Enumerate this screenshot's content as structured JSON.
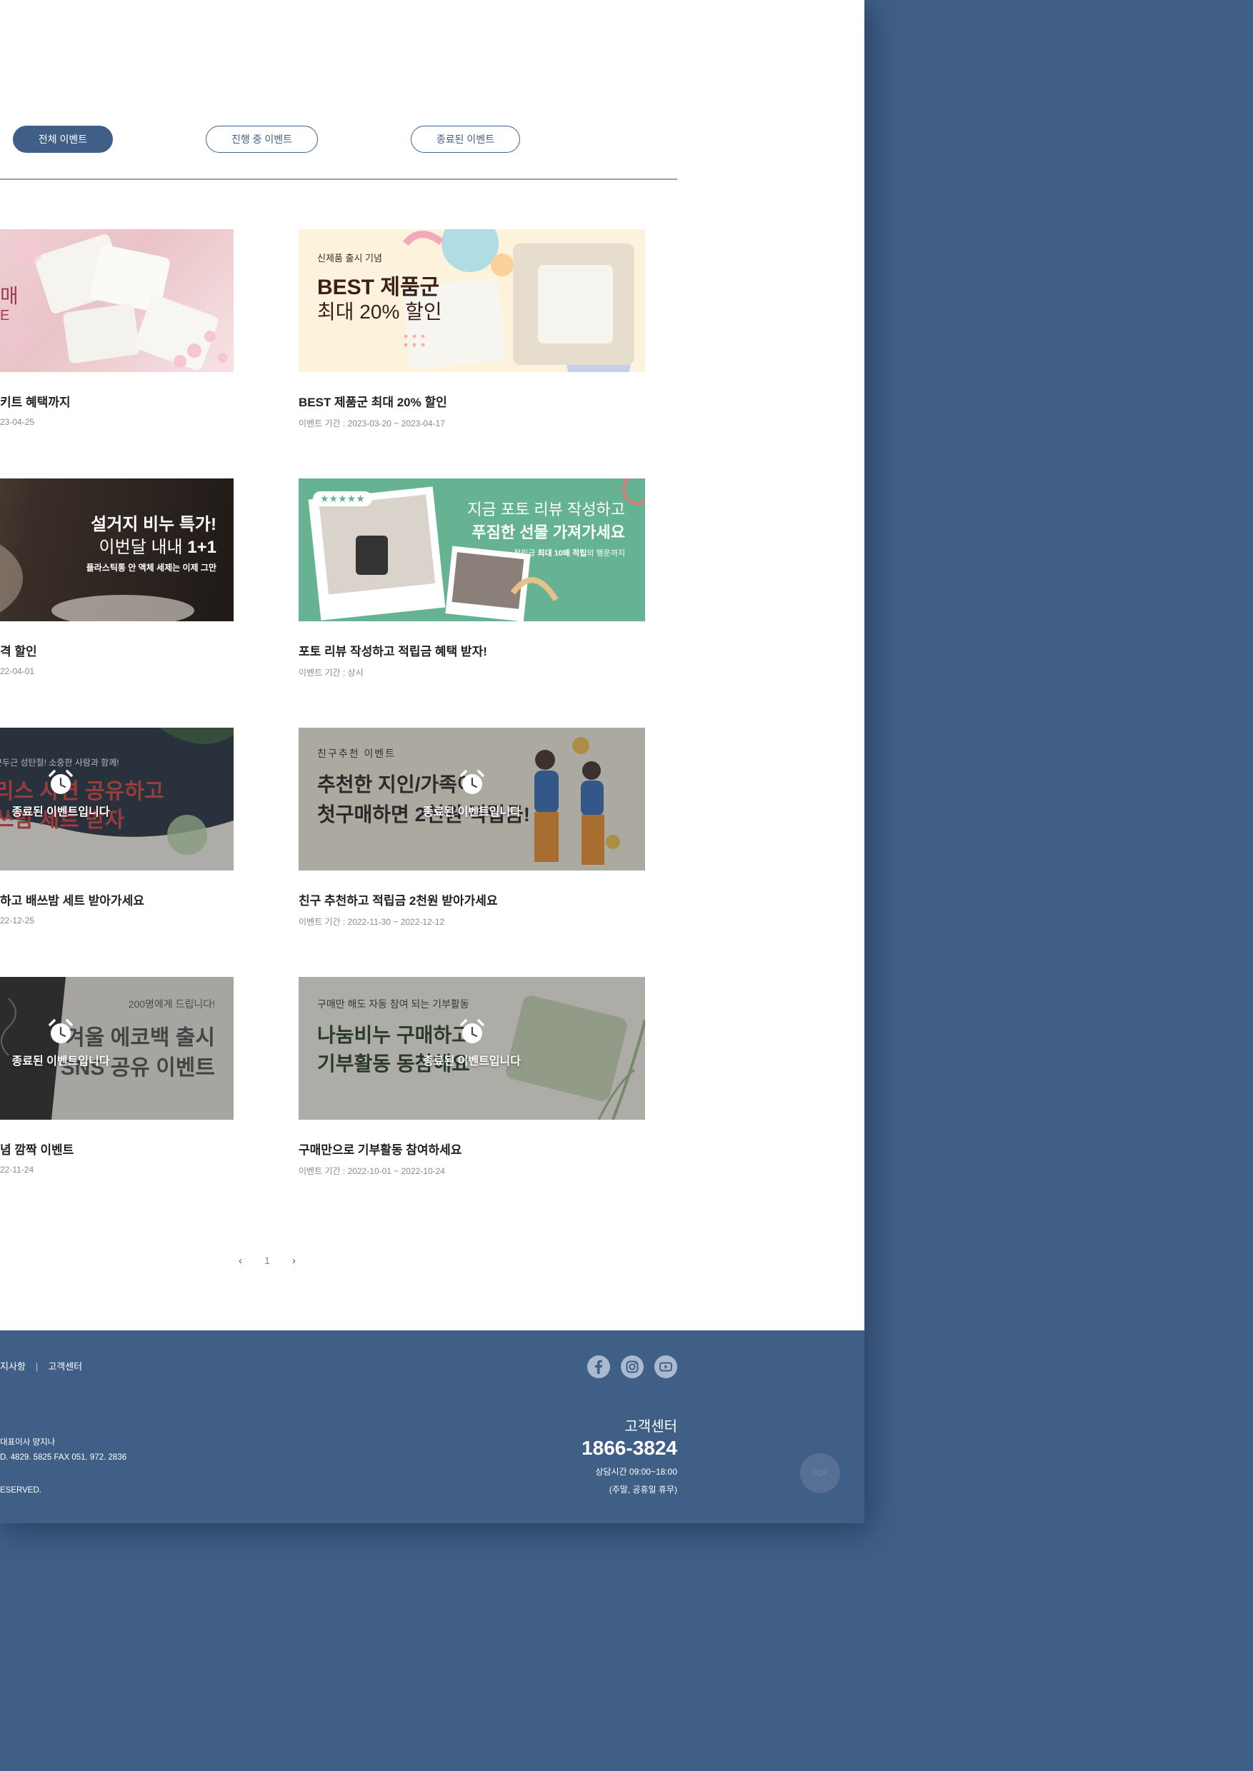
{
  "filters": {
    "all": "전체 이벤트",
    "ongoing": "진행 중 이벤트",
    "ended": "종료된 이벤트"
  },
  "ended_label": "종료된 이벤트입니다",
  "events": [
    {
      "title": "키트 혜택까지",
      "period": "23-04-25",
      "banner": {
        "line1": "매",
        "line2": "E"
      }
    },
    {
      "title": "BEST 제품군 최대 20% 할인",
      "period": "이벤트 기간 : 2023-03-20 ~ 2023-04-17",
      "banner": {
        "eyebrow": "신제품 출시 기념",
        "headline": "BEST 제품군",
        "sub": "최대 20% 할인"
      }
    },
    {
      "title": "격 할인",
      "period": "22-04-01",
      "banner": {
        "headline": "설거지 비누 특가!",
        "sub_plain": "이번달 내내 ",
        "sub_bold": "1+1",
        "note": "플라스틱통 안 액체 세제는 이제 그만"
      }
    },
    {
      "title": "포토 리뷰 작성하고 적립금 혜택 받자!",
      "period": "이벤트 기간 : 상시",
      "banner": {
        "stars": "★★★★★",
        "headline1": "지금 포토 리뷰 작성하고",
        "headline2": "푸짐한 선물 가져가세요",
        "note_plain1": "적립금 ",
        "note_bold": "최대 10배 적립",
        "note_plain2": "의 행운까지"
      }
    },
    {
      "title": "하고 배쓰밤 세트 받아가세요",
      "period": "22-12-25",
      "banner": {
        "eyebrow": "근두근 성탄절! 소중한 사람과 함께!",
        "headline1": "리스 사연 공유하고",
        "headline2": "쓰밤 세트 받자"
      }
    },
    {
      "title": "친구 추천하고 적립금 2천원 받아가세요",
      "period": "이벤트 기간 : 2022-11-30 ~ 2022-12-12",
      "banner": {
        "eyebrow": "친구추천 이벤트",
        "headline1": "추천한 지인/가족이",
        "headline2": "첫구매하면 2천원 적립금!"
      }
    },
    {
      "title": "념 깜짝 이벤트",
      "period": "22-11-24",
      "banner": {
        "eyebrow": "200명에게 드립니다!",
        "headline1": "겨울 에코백 출시",
        "headline2": "SNS 공유 이벤트"
      }
    },
    {
      "title": "구매만으로 기부활동 참여하세요",
      "period": "이벤트 기간 : 2022-10-01 ~ 2022-10-24",
      "banner": {
        "eyebrow": "구매만 해도 자동 참여 되는 기부활동",
        "headline1": "나눔비누 구매하고",
        "headline2": "기부활동 동참해요"
      }
    }
  ],
  "pagination": {
    "prev": "‹",
    "page": "1",
    "next": "›"
  },
  "footer": {
    "links": [
      "지사항",
      "고객센터"
    ],
    "link_sep": "|",
    "info": [
      "대표이사 양지나",
      "D. 4829. 5825 FAX 051. 972. 2836",
      "ESERVED."
    ],
    "social_icons": [
      "facebook-icon",
      "instagram-icon",
      "youtube-icon"
    ],
    "cs_title": "고객센터",
    "cs_phone": "1866-3824",
    "cs_hours": "상담시간 09:00~18:00",
    "cs_closed": "(주말, 공휴일 휴무)",
    "top_button": "TOP"
  },
  "colors": {
    "brand": "#3f5f86",
    "background": "#3f5f86",
    "page": "#ffffff",
    "review_green": "#66b394",
    "promo_cream": "#fdf3dc"
  }
}
